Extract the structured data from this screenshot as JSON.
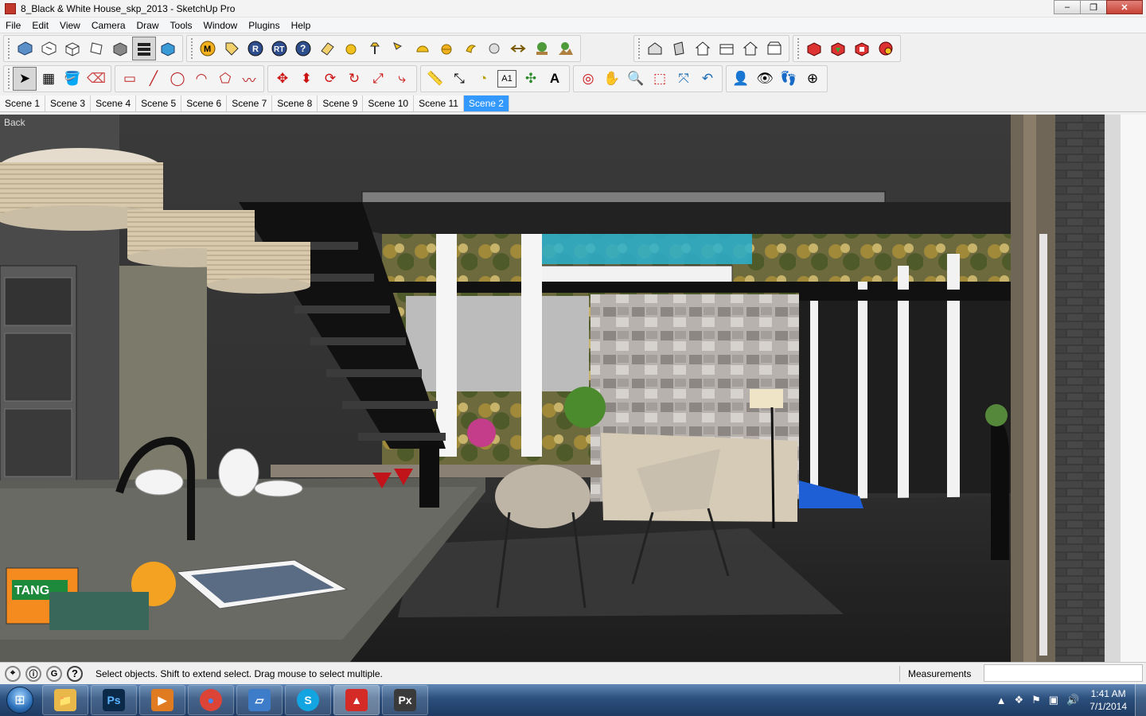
{
  "window": {
    "title": "8_Black & White House_skp_2013 - SketchUp Pro",
    "controls": [
      "–",
      "❐",
      "✕"
    ]
  },
  "menu": [
    "File",
    "Edit",
    "View",
    "Camera",
    "Draw",
    "Tools",
    "Window",
    "Plugins",
    "Help"
  ],
  "toolbar1": {
    "groupA": [
      "get-models-icon",
      "share-model-icon",
      "iso-view-icon",
      "top-view-icon",
      "front-view-icon",
      "layers-icon",
      "outliner-icon"
    ],
    "groupB": [
      "m-plugin-icon",
      "tag-plugin-icon",
      "r-plugin-icon",
      "rt-plugin-icon",
      "help-plugin-icon",
      "eraser-plugin-icon",
      "sphere-icon",
      "lamp-icon",
      "spotlight-icon",
      "dome-icon",
      "half-sphere-icon",
      "moon-icon",
      "orb-icon",
      "arrows-icon",
      "tree-icon",
      "landscape-icon"
    ],
    "groupC": [
      "house-iso-icon",
      "house-side-icon",
      "house-front-icon",
      "house-top-icon",
      "house-outline-icon",
      "house-back-icon"
    ],
    "groupD": [
      "ruby-1-icon",
      "ruby-2-icon",
      "ruby-3-icon",
      "ruby-4-icon"
    ]
  },
  "toolbar2": {
    "select_active": true,
    "glyphs": {
      "select": "➤",
      "component": "▦",
      "paint": "🪣",
      "eraser": "⌫",
      "rectangle": "▭",
      "line": "╱",
      "circle": "◯",
      "arc": "◠",
      "polygon": "⬠",
      "freehand": "〰",
      "move": "✥",
      "pushpull": "⬍",
      "rotate": "⟳",
      "followme": "↻",
      "scale": "⤢",
      "offset": "⤷",
      "tape": "📏",
      "dimension": "⤡",
      "protractor": "◔",
      "text": "A1",
      "axes": "✣",
      "3dtext": "A",
      "orbit": "◎",
      "pan": "✋",
      "zoom": "🔍",
      "zoomwindow": "⬚",
      "zoomextents": "⤧",
      "previous": "↶",
      "position": "👤",
      "lookaround": "👁",
      "walk": "👣",
      "section": "⊕"
    }
  },
  "scenes": {
    "tabs": [
      "Scene 1",
      "Scene 3",
      "Scene 4",
      "Scene 5",
      "Scene 6",
      "Scene 7",
      "Scene 8",
      "Scene 9",
      "Scene 10",
      "Scene 11",
      "Scene 2"
    ],
    "active": "Scene 2"
  },
  "viewport": {
    "back_label": "Back",
    "orange_label": "TANG"
  },
  "status": {
    "text": "Select objects. Shift to extend select. Drag mouse to select multiple.",
    "measurements_label": "Measurements",
    "measurements_value": ""
  },
  "taskbar": {
    "apps": [
      {
        "name": "explorer",
        "label": "📁",
        "color": "#e8b84a"
      },
      {
        "name": "photoshop",
        "label": "Ps",
        "color": "#0b2a4a"
      },
      {
        "name": "media",
        "label": "▶",
        "color": "#e07b22"
      },
      {
        "name": "chrome",
        "label": "●",
        "color": "#db4437"
      },
      {
        "name": "file",
        "label": "▱",
        "color": "#3d7cc9"
      },
      {
        "name": "skype",
        "label": "S",
        "color": "#12a5e2"
      },
      {
        "name": "sketchup",
        "label": "▲",
        "color": "#d42b27"
      },
      {
        "name": "px",
        "label": "Px",
        "color": "#3a3a3a"
      }
    ],
    "time": "1:41 AM",
    "date": "7/1/2014"
  }
}
